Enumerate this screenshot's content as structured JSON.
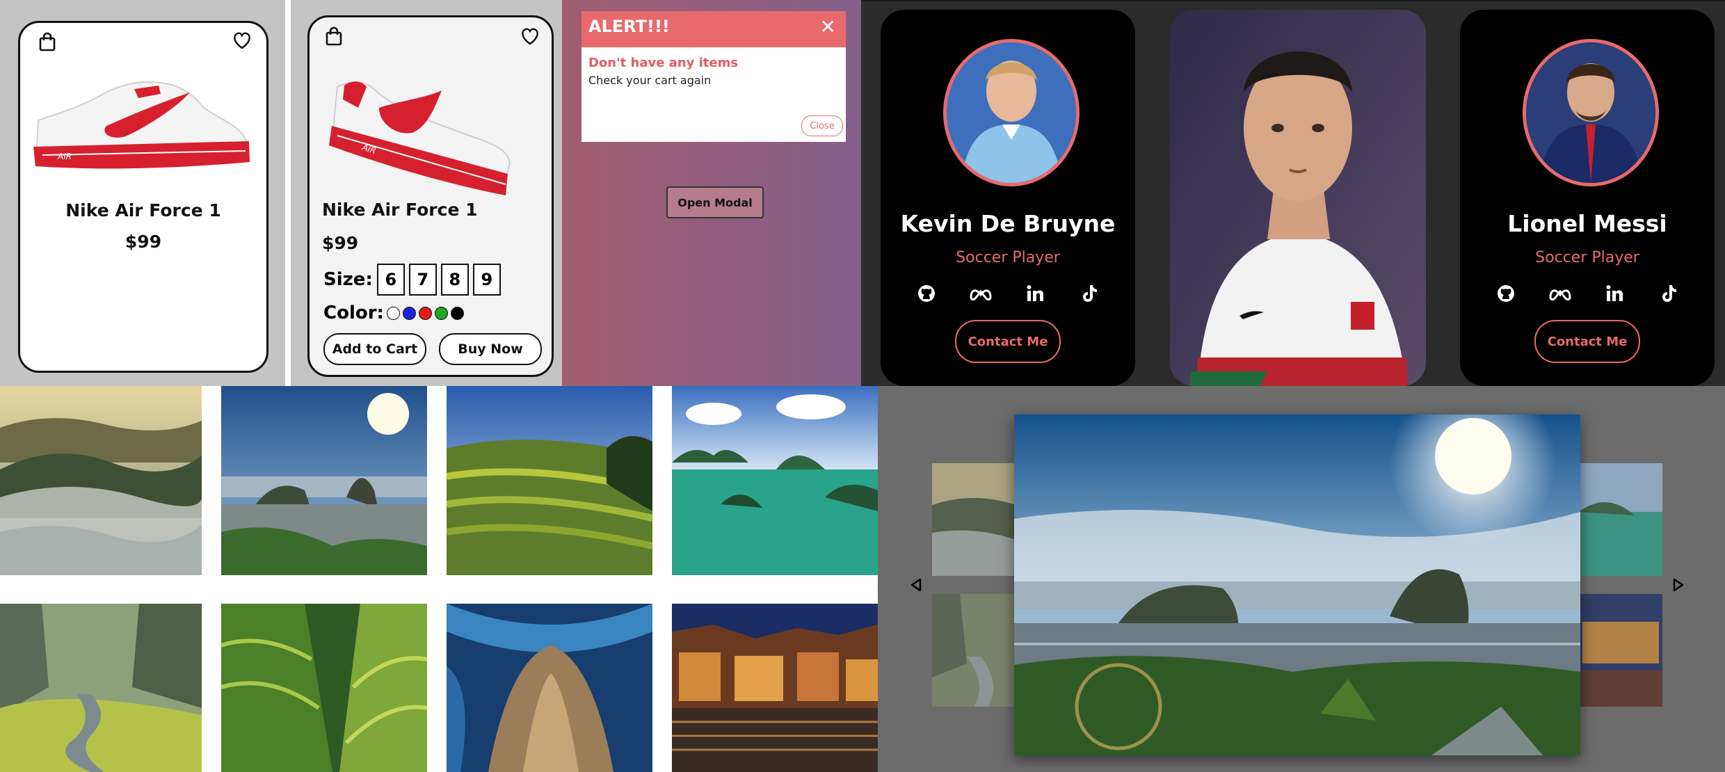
{
  "product_card_1": {
    "name": "Nike Air Force 1",
    "price": "$99",
    "icons": [
      "shopping-bag-icon",
      "heart-icon"
    ],
    "colors": {
      "shoe": "#e2202f"
    }
  },
  "product_card_2": {
    "name": "Nike Air Force 1",
    "price": "$99",
    "size_label": "Size:",
    "sizes": [
      "6",
      "7",
      "8",
      "9"
    ],
    "color_label": "Color:",
    "swatches": [
      "#ffffff",
      "#1a23e0",
      "#e8171c",
      "#1ea81f",
      "#000000"
    ],
    "add_to_cart": "Add to Cart",
    "buy_now": "Buy Now"
  },
  "alert_modal": {
    "title": "ALERT!!!",
    "close_glyph": "✕",
    "heading": "Don't have any items",
    "message": "Check your cart again",
    "close_button": "Close",
    "open_button": "Open Modal",
    "colors": {
      "accent": "#e86a6c"
    }
  },
  "profiles": [
    {
      "name": "Kevin De Bruyne",
      "role": "Soccer Player",
      "contact": "Contact Me"
    },
    {
      "name": "Lionel Messi",
      "role": "Soccer Player",
      "contact": "Contact Me"
    }
  ],
  "social_icons": [
    "github-icon",
    "meta-icon",
    "linkedin-icon",
    "tiktok-icon"
  ],
  "gallery": {
    "photos": [
      "misty-hills",
      "coastal-city",
      "rice-terraces",
      "bay-islands",
      "river-valley",
      "terraced-mountains",
      "cave",
      "night-riverside"
    ]
  },
  "carousel": {
    "arrows": [
      "caret-left-icon",
      "caret-right-icon"
    ]
  }
}
